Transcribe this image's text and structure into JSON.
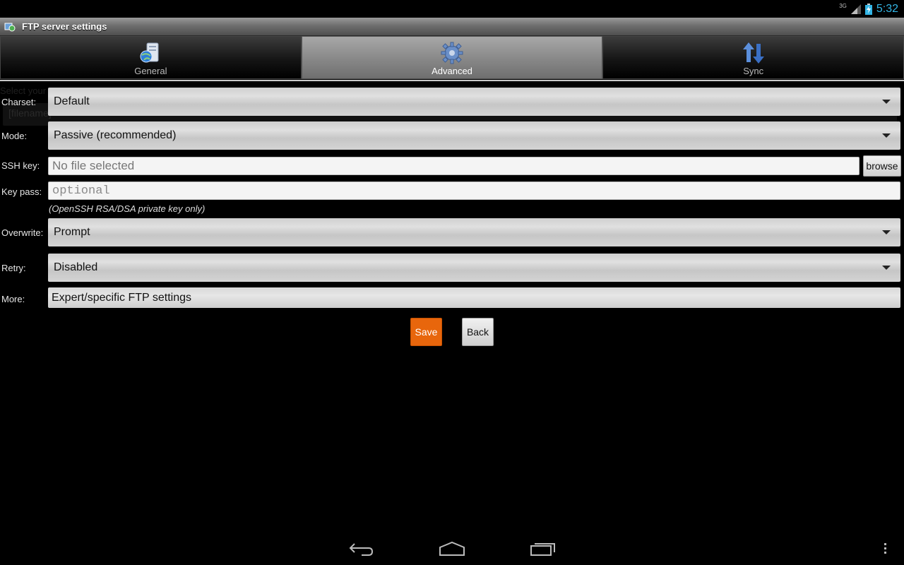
{
  "status_bar": {
    "network": "3G",
    "time": "5:32"
  },
  "title_bar": {
    "title": "FTP server settings"
  },
  "tabs": [
    {
      "label": "General",
      "icon": "globe-server-icon",
      "active": false
    },
    {
      "label": "Advanced",
      "icon": "gear-icon",
      "active": true
    },
    {
      "label": "Sync",
      "icon": "sync-arrows-icon",
      "active": false
    }
  ],
  "background_ghost": {
    "line1": "Select your",
    "line2": "[filename]"
  },
  "form": {
    "charset": {
      "label": "Charset:",
      "value": "Default"
    },
    "mode": {
      "label": "Mode:",
      "value": "Passive (recommended)"
    },
    "ssh_key": {
      "label": "SSH key:",
      "value": "No file selected",
      "browse_label": "browse"
    },
    "key_pass": {
      "label": "Key pass:",
      "placeholder": "optional",
      "hint": "(OpenSSH RSA/DSA private key only)"
    },
    "overwrite": {
      "label": "Overwrite:",
      "value": "Prompt"
    },
    "retry": {
      "label": "Retry:",
      "value": "Disabled"
    },
    "more": {
      "label": "More:",
      "value": "Expert/specific FTP settings"
    }
  },
  "buttons": {
    "save": "Save",
    "back": "Back"
  },
  "colors": {
    "accent": "#e8660c",
    "clock": "#33b5e5",
    "background": "#000000"
  },
  "nav_bar": {
    "icons": [
      "back-icon",
      "home-icon",
      "recent-apps-icon",
      "overflow-menu-icon"
    ]
  }
}
